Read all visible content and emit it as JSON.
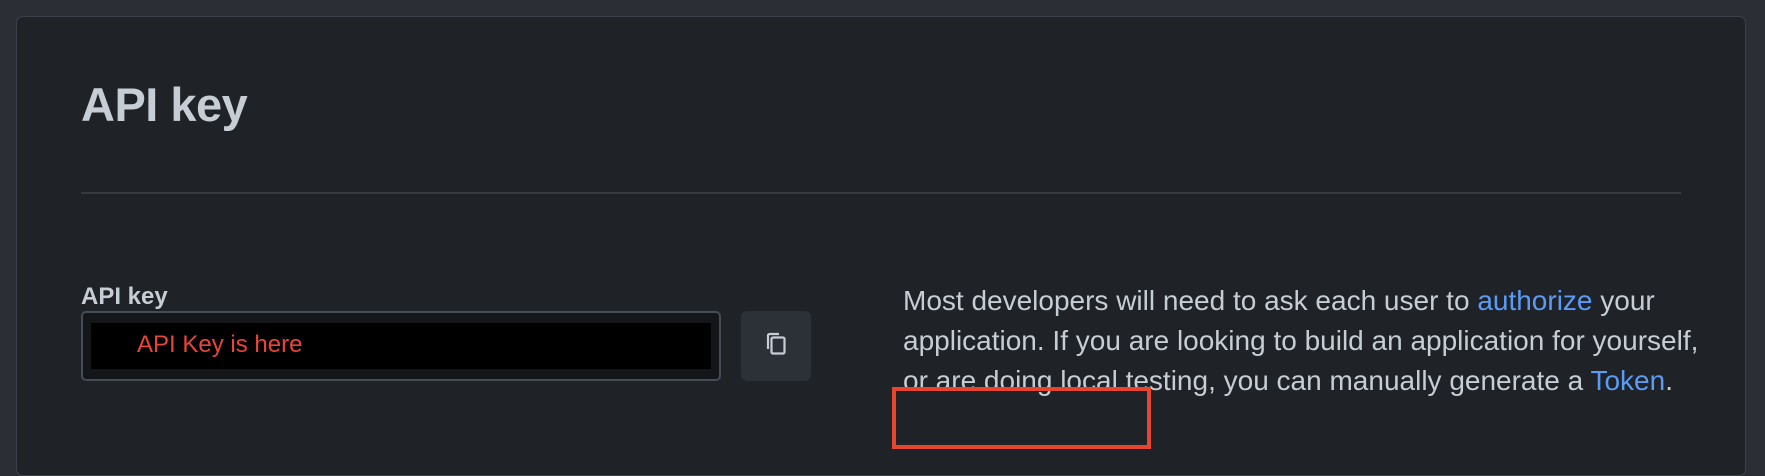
{
  "section": {
    "title": "API key"
  },
  "api_key_field": {
    "label": "API key",
    "value": "API Key is here"
  },
  "copy_button": {
    "icon": "copy-icon"
  },
  "help": {
    "text_before_authorize": "Most developers will need to ask each user to ",
    "authorize_link": "authorize",
    "text_middle": " your application. If you are looking to build an application for yourself, or are doing local testing, you can manually generate a ",
    "token_link": "Token",
    "text_end": "."
  },
  "colors": {
    "background": "#2b2f35",
    "panel": "#1f2227",
    "text": "#c7cdd5",
    "link": "#5b9bf5",
    "key_text": "#e8453a",
    "highlight": "#e8452d"
  }
}
